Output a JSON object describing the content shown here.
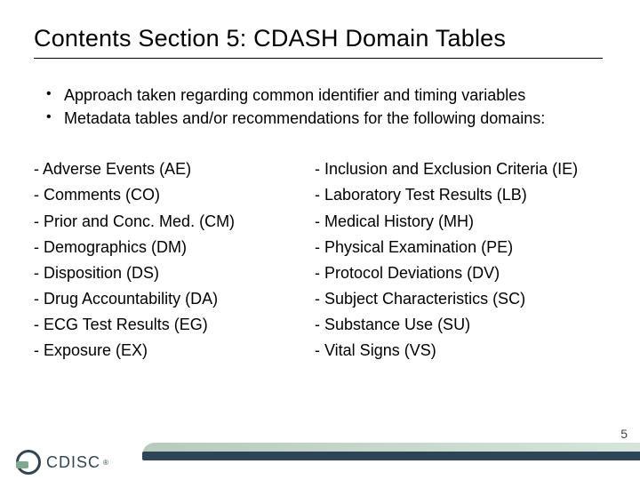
{
  "title": "Contents Section 5: CDASH Domain Tables",
  "intro": [
    "Approach taken regarding common identifier and timing variables",
    "Metadata tables and/or recommendations for the following domains:"
  ],
  "domains_left": [
    "- Adverse Events (AE)",
    "- Comments (CO)",
    "- Prior and Conc. Med. (CM)",
    "- Demographics (DM)",
    "- Disposition (DS)",
    "- Drug Accountability (DA)",
    "- ECG Test Results (EG)",
    "- Exposure (EX)"
  ],
  "domains_right": [
    "- Inclusion and Exclusion Criteria (IE)",
    "- Laboratory Test Results (LB)",
    "- Medical History (MH)",
    "- Physical Examination (PE)",
    "- Protocol Deviations (DV)",
    "- Subject Characteristics (SC)",
    "- Substance Use (SU)",
    "- Vital Signs (VS)"
  ],
  "page_number": "5",
  "logo_text": "CDISC",
  "logo_tm": "®"
}
